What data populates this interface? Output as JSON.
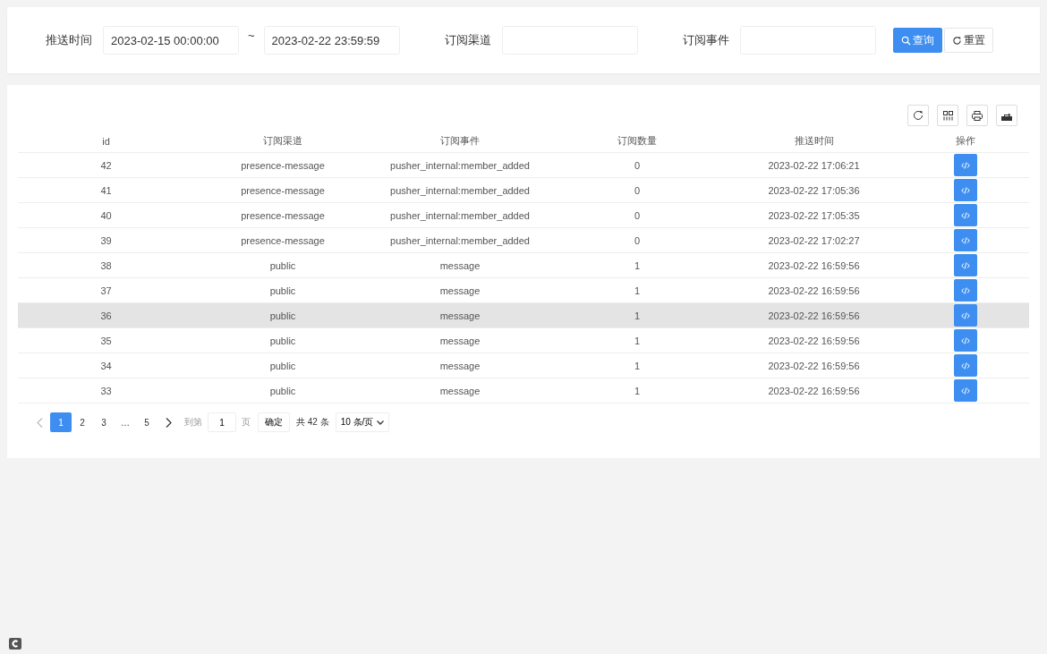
{
  "filters": {
    "time_label": "推送时间",
    "time_start": "2023-02-15 00:00:00",
    "separator": "~",
    "time_end": "2023-02-22 23:59:59",
    "channel_label": "订阅渠道",
    "event_label": "订阅事件",
    "search_button": "查询",
    "reset_button": "重置"
  },
  "table": {
    "columns": [
      "id",
      "订阅渠道",
      "订阅事件",
      "订阅数量",
      "推送时间",
      "操作"
    ],
    "rows": [
      {
        "cells": [
          "42",
          "presence-message",
          "pusher_internal:member_added",
          "0",
          "2023-02-22 17:06:21"
        ],
        "highlighted": false
      },
      {
        "cells": [
          "41",
          "presence-message",
          "pusher_internal:member_added",
          "0",
          "2023-02-22 17:05:36"
        ],
        "highlighted": false
      },
      {
        "cells": [
          "40",
          "presence-message",
          "pusher_internal:member_added",
          "0",
          "2023-02-22 17:05:35"
        ],
        "highlighted": false
      },
      {
        "cells": [
          "39",
          "presence-message",
          "pusher_internal:member_added",
          "0",
          "2023-02-22 17:02:27"
        ],
        "highlighted": false
      },
      {
        "cells": [
          "38",
          "public",
          "message",
          "1",
          "2023-02-22 16:59:56"
        ],
        "highlighted": false
      },
      {
        "cells": [
          "37",
          "public",
          "message",
          "1",
          "2023-02-22 16:59:56"
        ],
        "highlighted": false
      },
      {
        "cells": [
          "36",
          "public",
          "message",
          "1",
          "2023-02-22 16:59:56"
        ],
        "highlighted": true
      },
      {
        "cells": [
          "35",
          "public",
          "message",
          "1",
          "2023-02-22 16:59:56"
        ],
        "highlighted": false
      },
      {
        "cells": [
          "34",
          "public",
          "message",
          "1",
          "2023-02-22 16:59:56"
        ],
        "highlighted": false
      },
      {
        "cells": [
          "33",
          "public",
          "message",
          "1",
          "2023-02-22 16:59:56"
        ],
        "highlighted": false
      }
    ]
  },
  "pagination": {
    "prev_disabled": true,
    "pages": [
      {
        "label": "1",
        "selected": true
      },
      {
        "label": "2",
        "selected": false
      },
      {
        "label": "3",
        "selected": false
      },
      {
        "label": "…",
        "selected": false
      },
      {
        "label": "5",
        "selected": false
      }
    ],
    "goto_label": "到第",
    "goto_value": "1",
    "page_unit": "页",
    "confirm_button": "确定",
    "total": "共 42 条",
    "page_size": "10 条/页"
  }
}
